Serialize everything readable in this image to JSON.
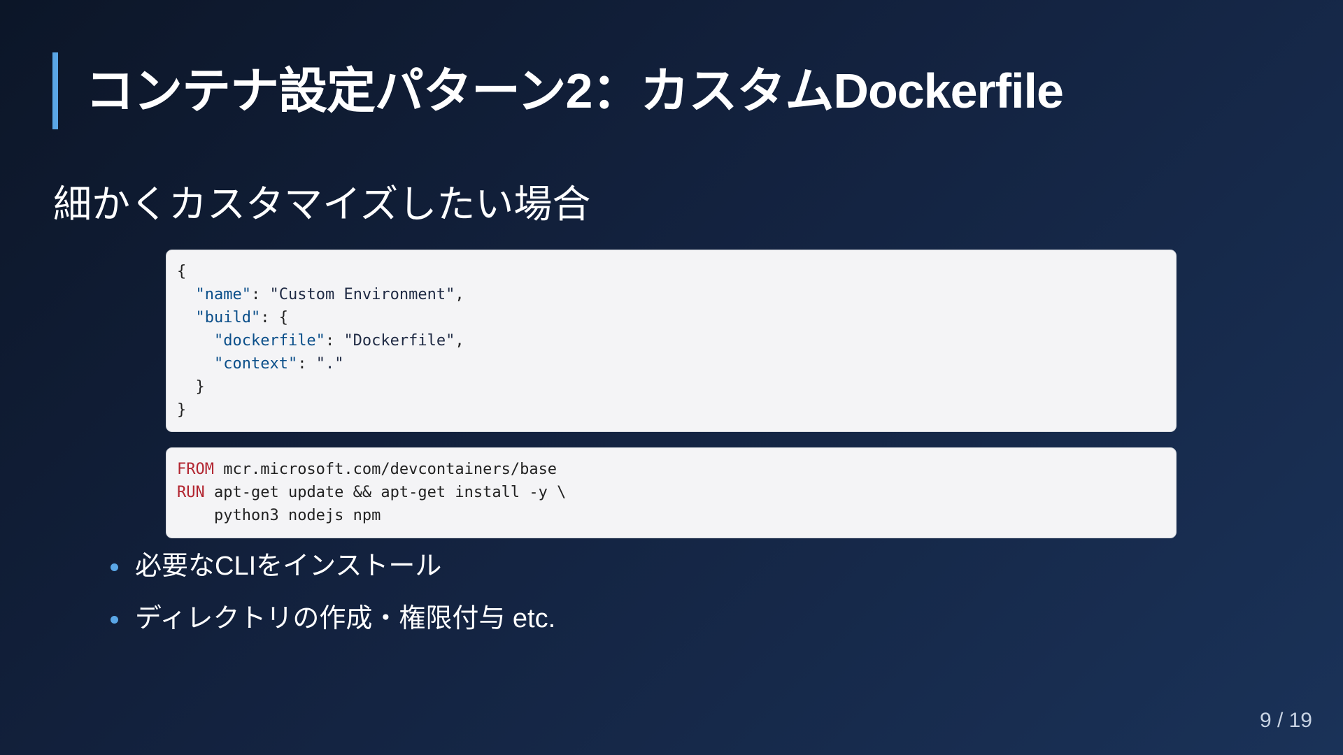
{
  "slide": {
    "title": "コンテナ設定パターン2：カスタムDockerfile",
    "subtitle": "細かくカスタマイズしたい場合",
    "json_code": {
      "lines": [
        {
          "indent": "",
          "parts": [
            {
              "t": "{",
              "c": "p"
            }
          ]
        },
        {
          "indent": "  ",
          "parts": [
            {
              "t": "\"name\"",
              "c": "k"
            },
            {
              "t": ": ",
              "c": "p"
            },
            {
              "t": "\"Custom Environment\"",
              "c": "s"
            },
            {
              "t": ",",
              "c": "p"
            }
          ]
        },
        {
          "indent": "  ",
          "parts": [
            {
              "t": "\"build\"",
              "c": "k"
            },
            {
              "t": ": {",
              "c": "p"
            }
          ]
        },
        {
          "indent": "    ",
          "parts": [
            {
              "t": "\"dockerfile\"",
              "c": "k"
            },
            {
              "t": ": ",
              "c": "p"
            },
            {
              "t": "\"Dockerfile\"",
              "c": "s"
            },
            {
              "t": ",",
              "c": "p"
            }
          ]
        },
        {
          "indent": "    ",
          "parts": [
            {
              "t": "\"context\"",
              "c": "k"
            },
            {
              "t": ": ",
              "c": "p"
            },
            {
              "t": "\".\"",
              "c": "s"
            }
          ]
        },
        {
          "indent": "  ",
          "parts": [
            {
              "t": "}",
              "c": "p"
            }
          ]
        },
        {
          "indent": "",
          "parts": [
            {
              "t": "}",
              "c": "p"
            }
          ]
        }
      ]
    },
    "docker_code": {
      "lines": [
        {
          "indent": "",
          "parts": [
            {
              "t": "FROM",
              "c": "kw"
            },
            {
              "t": " mcr.microsoft.com/devcontainers/base",
              "c": "p"
            }
          ]
        },
        {
          "indent": "",
          "parts": [
            {
              "t": "RUN",
              "c": "kw"
            },
            {
              "t": " apt-get update && apt-get install -y \\",
              "c": "p"
            }
          ]
        },
        {
          "indent": "    ",
          "parts": [
            {
              "t": "python3 nodejs npm",
              "c": "p"
            }
          ]
        }
      ]
    },
    "bullets": [
      "必要なCLIをインストール",
      "ディレクトリの作成・権限付与 etc."
    ],
    "page_number": "9 / 19"
  },
  "colors": {
    "accent": "#5aa6e6",
    "code_bg": "#f4f4f6",
    "keyword": "#b22530",
    "json_key": "#0b4f8a"
  }
}
